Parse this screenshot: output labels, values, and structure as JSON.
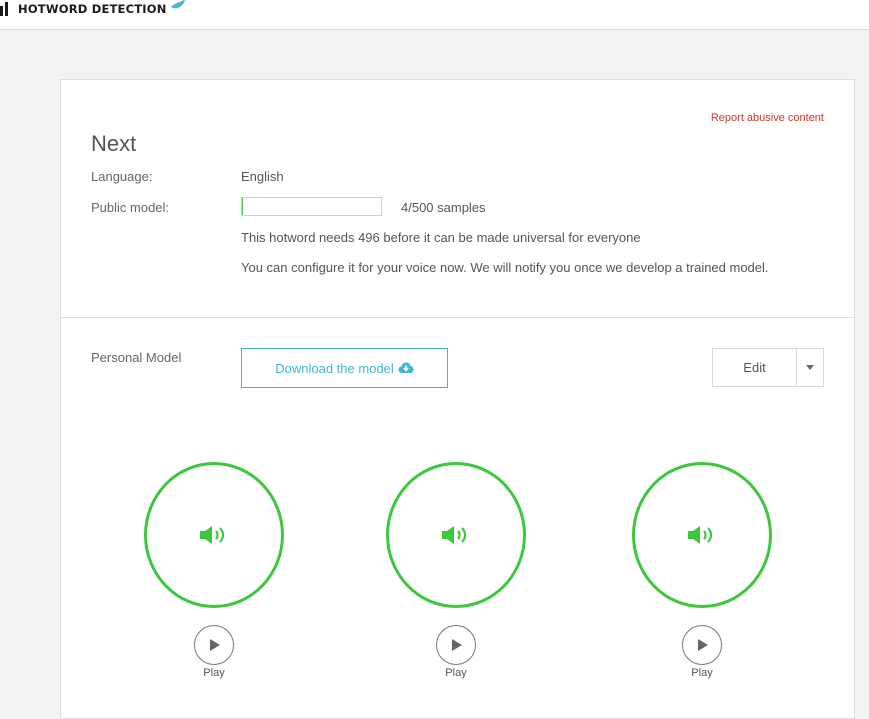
{
  "header": {
    "brand": "HOTWORD DETECTION",
    "logo_icon": "bars-logo-icon",
    "bird_icon": "bird-icon"
  },
  "card": {
    "report_link": "Report abusive content",
    "title": "Next",
    "language_label": "Language:",
    "language_value": "English",
    "public_model_label": "Public model:",
    "samples_text": "4/500 samples",
    "progress_fraction": 0.008,
    "needs_text": "This hotword needs 496 before it can be made universal for everyone",
    "configure_text": "You can configure it for your voice now. We will notify you once we develop a trained model.",
    "personal_model_label": "Personal Model",
    "download_label": "Download the model",
    "download_icon": "cloud-download-icon",
    "edit_label": "Edit",
    "caret_icon": "caret-down-icon"
  },
  "samples": [
    {
      "play_label": "Play",
      "icon": "speaker-icon"
    },
    {
      "play_label": "Play",
      "icon": "speaker-icon"
    },
    {
      "play_label": "Play",
      "icon": "speaker-icon"
    }
  ],
  "colors": {
    "accent_green": "#3cc73c",
    "download_blue": "#3fb6d3",
    "report_red": "#d0342c"
  }
}
